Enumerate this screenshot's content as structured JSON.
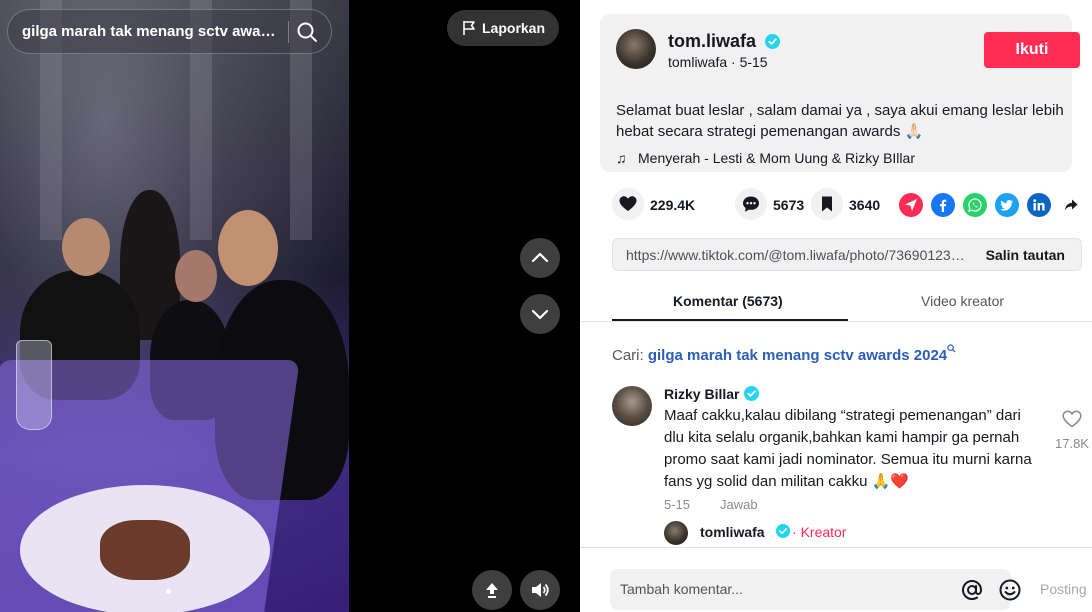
{
  "search": {
    "query": "gilga marah tak menang sctv awards 2024"
  },
  "media": {
    "report_label": "Laporkan"
  },
  "post": {
    "username": "tom.liwafa",
    "handle_date": "tomliwafa · 5-15",
    "follow_label": "Ikuti",
    "caption": "Selamat buat leslar , salam damai ya , saya akui emang leslar lebih hebat secara strategi pemenangan awards 🙏🏻",
    "music": "Menyerah - Lesti & Mom Uung & Rizky BIllar"
  },
  "actions": {
    "likes": "229.4K",
    "comments": "5673",
    "saves": "3640"
  },
  "link": {
    "url": "https://www.tiktok.com/@tom.liwafa/photo/7369012345678901234",
    "copy_label": "Salin tautan"
  },
  "tabs": [
    {
      "label": "Komentar (5673)"
    },
    {
      "label": "Video kreator"
    }
  ],
  "cari": {
    "prefix": "Cari:",
    "term": "gilga marah tak menang sctv awards 2024"
  },
  "comment": {
    "author": "Rizky Billar",
    "text": "Maaf cakku,kalau dibilang “strategi pemenangan” dari dlu kita selalu organik,bahkan kami hampir ga pernah promo saat kami jadi nominator. Semua itu murni karna fans yg solid dan militan cakku 🙏❤️",
    "date": "5-15",
    "reply_label": "Jawab",
    "like_count": "17.8K"
  },
  "reply": {
    "author": "tomliwafa",
    "dot": "·",
    "badge": "Kreator"
  },
  "footer": {
    "placeholder": "Tambah komentar...",
    "post_label": "Posting"
  },
  "colors": {
    "accent": "#fe2c55",
    "verified": "#20d5ec",
    "link": "#2b5db9"
  }
}
